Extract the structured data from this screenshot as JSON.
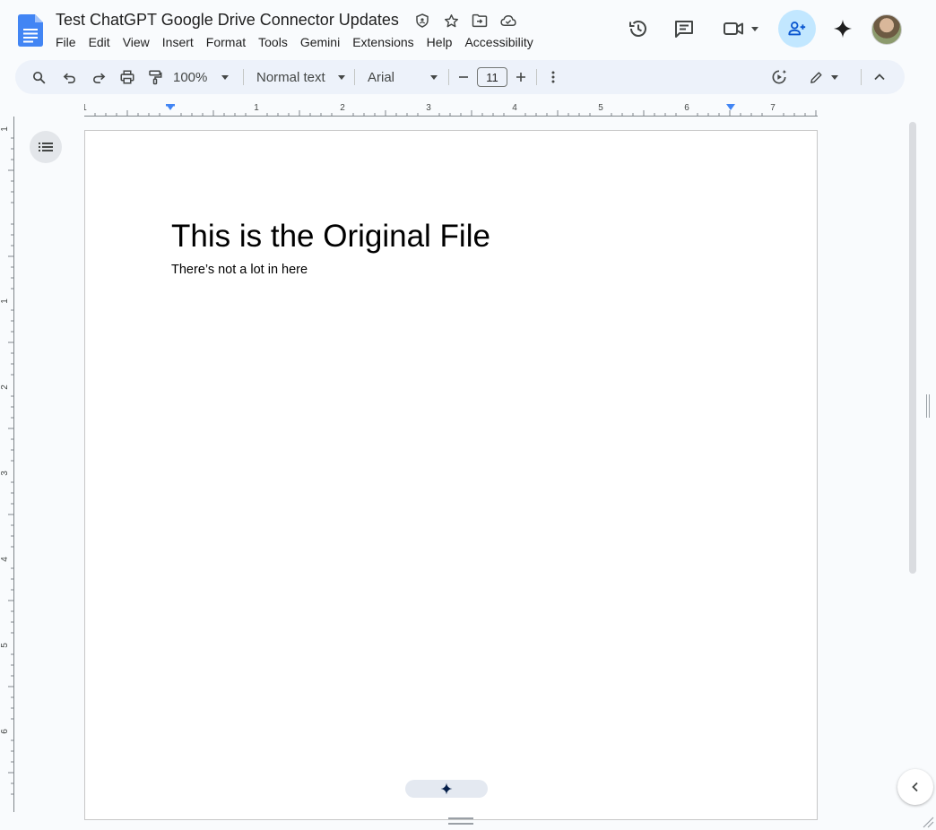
{
  "document": {
    "title": "Test ChatGPT Google Drive Connector Updates",
    "heading": "This is the Original File",
    "body_text": "There’s not a lot in here"
  },
  "menu": {
    "file": "File",
    "edit": "Edit",
    "view": "View",
    "insert": "Insert",
    "format": "Format",
    "tools": "Tools",
    "gemini": "Gemini",
    "extensions": "Extensions",
    "help": "Help",
    "accessibility": "Accessibility"
  },
  "toolbar": {
    "zoom": "100%",
    "paragraph_style": "Normal text",
    "font_family": "Arial",
    "font_size": "11"
  },
  "ruler": {
    "horizontal_labels": [
      "1",
      "1",
      "2",
      "3",
      "4",
      "5",
      "6",
      "7"
    ],
    "vertical_labels": [
      "1",
      "1",
      "2",
      "3",
      "4",
      "5",
      "6"
    ]
  },
  "colors": {
    "accent": "#0b57d0",
    "share_bg": "#c2e7ff",
    "toolbar_bg": "#edf2fa",
    "docs_blue": "#4285f4"
  },
  "icons": {
    "title": [
      "move-to-shared-drive-icon",
      "star-icon",
      "move-folder-icon",
      "cloud-saved-icon"
    ],
    "right": [
      "version-history-icon",
      "comments-icon",
      "meet-video-icon",
      "share-person-add-icon",
      "gemini-sparkle-icon"
    ]
  }
}
